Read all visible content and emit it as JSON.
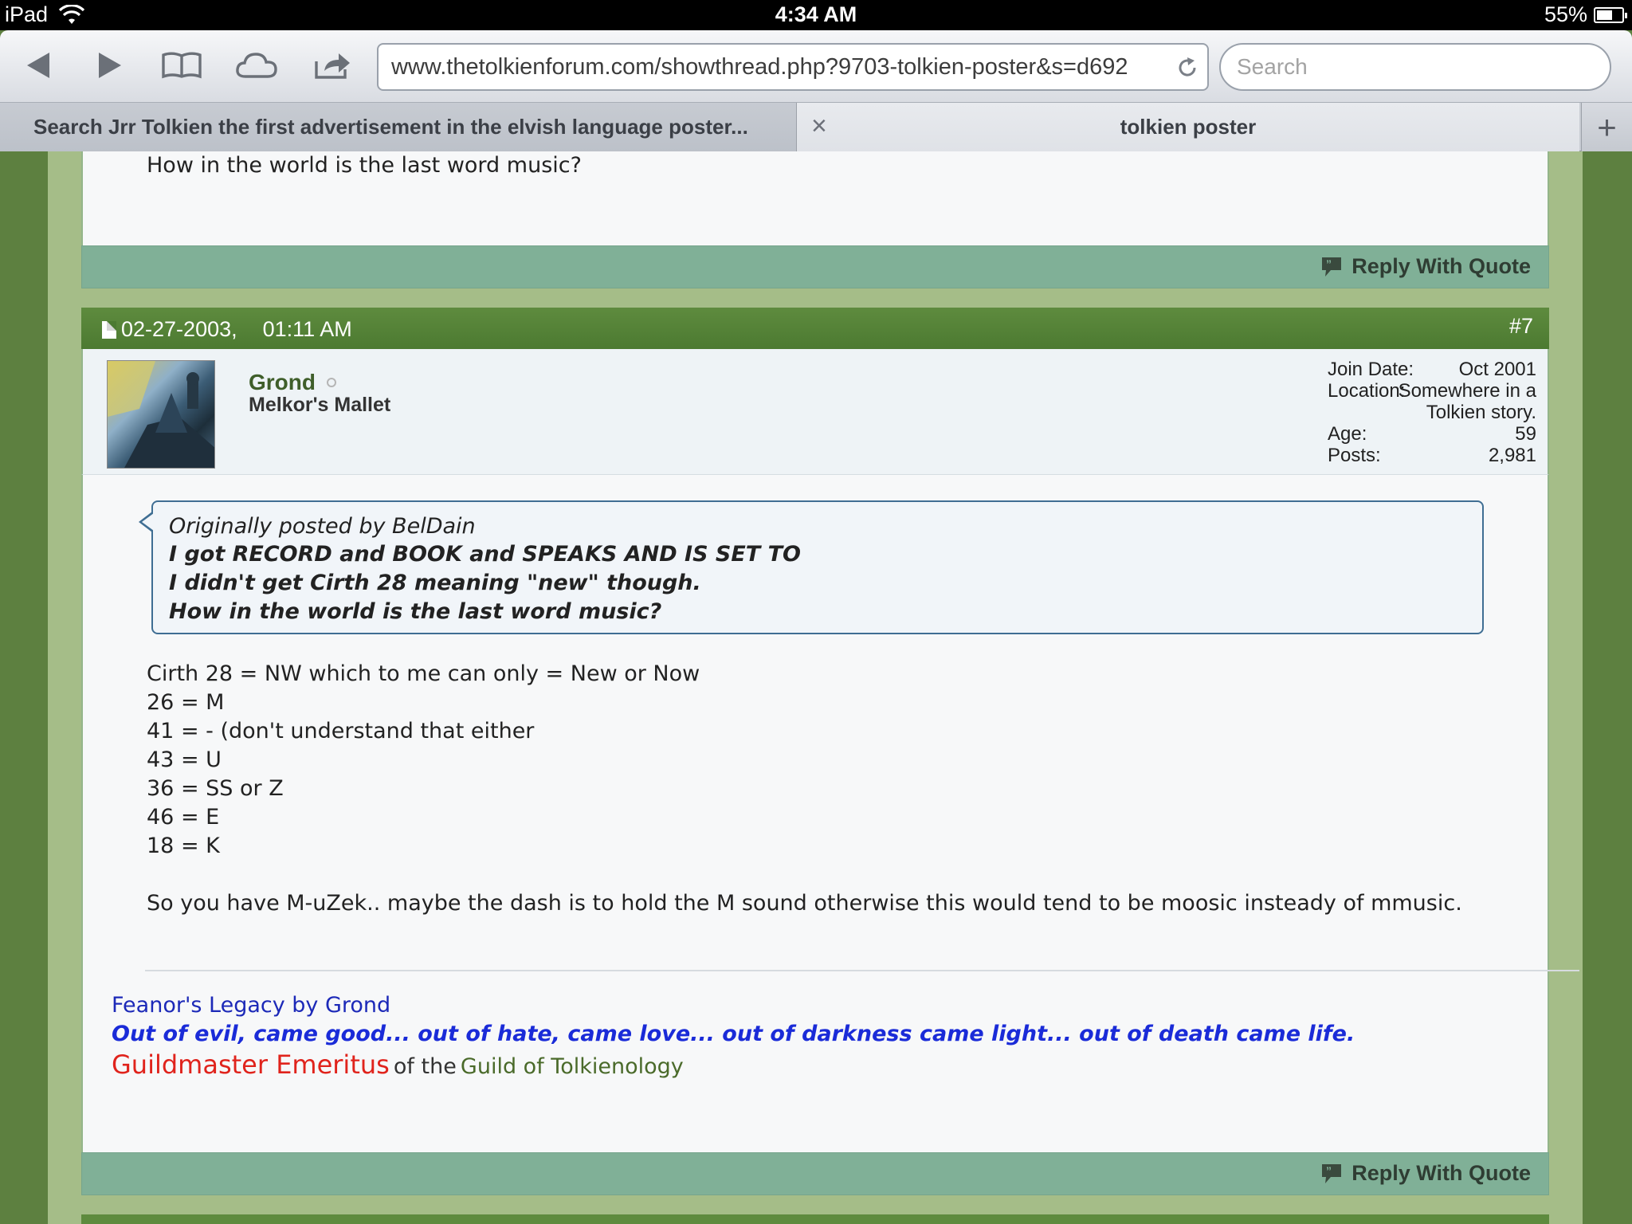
{
  "status_bar": {
    "device": "iPad",
    "time": "4:34 AM",
    "battery_pct": "55%",
    "battery_level": 0.55
  },
  "toolbar": {
    "url": "www.thetolkienforum.com/showthread.php?9703-tolkien-poster&s=d692",
    "search_placeholder": "Search"
  },
  "tabs": [
    {
      "label": "Search Jrr Tolkien the first advertisement in the elvish language poster..."
    },
    {
      "label": "tolkien poster",
      "close": "×"
    }
  ],
  "new_tab": "+",
  "previous_post": {
    "last_line": "How in the world is the last word music?",
    "reply_label": "Reply With Quote"
  },
  "post": {
    "date": "02-27-2003,",
    "time": "01:11 AM",
    "number": "#7",
    "user": {
      "name": "Grond",
      "title": "Melkor's Mallet",
      "stats": [
        {
          "key": "Join Date:",
          "value": "Oct 2001"
        },
        {
          "key": "Location:",
          "value": "Somewhere in a Tolkien story."
        },
        {
          "key": "Age:",
          "value": "59"
        },
        {
          "key": "Posts:",
          "value": "2,981"
        }
      ]
    },
    "quote": {
      "by": "Originally posted by BelDain",
      "lines": [
        "I got RECORD and BOOK and SPEAKS AND IS SET TO",
        "I didn't get Cirth 28 meaning \"new\" though.",
        "How in the world is the last word music?"
      ]
    },
    "message_lines": [
      "Cirth 28 = NW which to me can only = New or Now",
      "26 = M",
      "41 = - (don't understand that either",
      "43 = U",
      "36 = SS or Z",
      "46 = E",
      "18 = K",
      "So you have M-uZek.. maybe the dash is to hold the M sound otherwise this would tend to be moosic insteady of mmusic."
    ],
    "signature": {
      "link": "Feanor's Legacy by Grond",
      "motto": "Out of evil, came good... out of hate, came love... out of darkness came light... out of death came life.",
      "guild_title": "Guildmaster Emeritus",
      "guild_of": "of the",
      "guild_name": "Guild of Tolkienology"
    },
    "reply_label": "Reply With Quote"
  },
  "colors": {
    "forum_green": "#5e8b3e",
    "reply_bar": "#80b097",
    "quote_border": "#3f6e93",
    "sig_blue": "#1a2bd8",
    "sig_red": "#e0231c"
  }
}
